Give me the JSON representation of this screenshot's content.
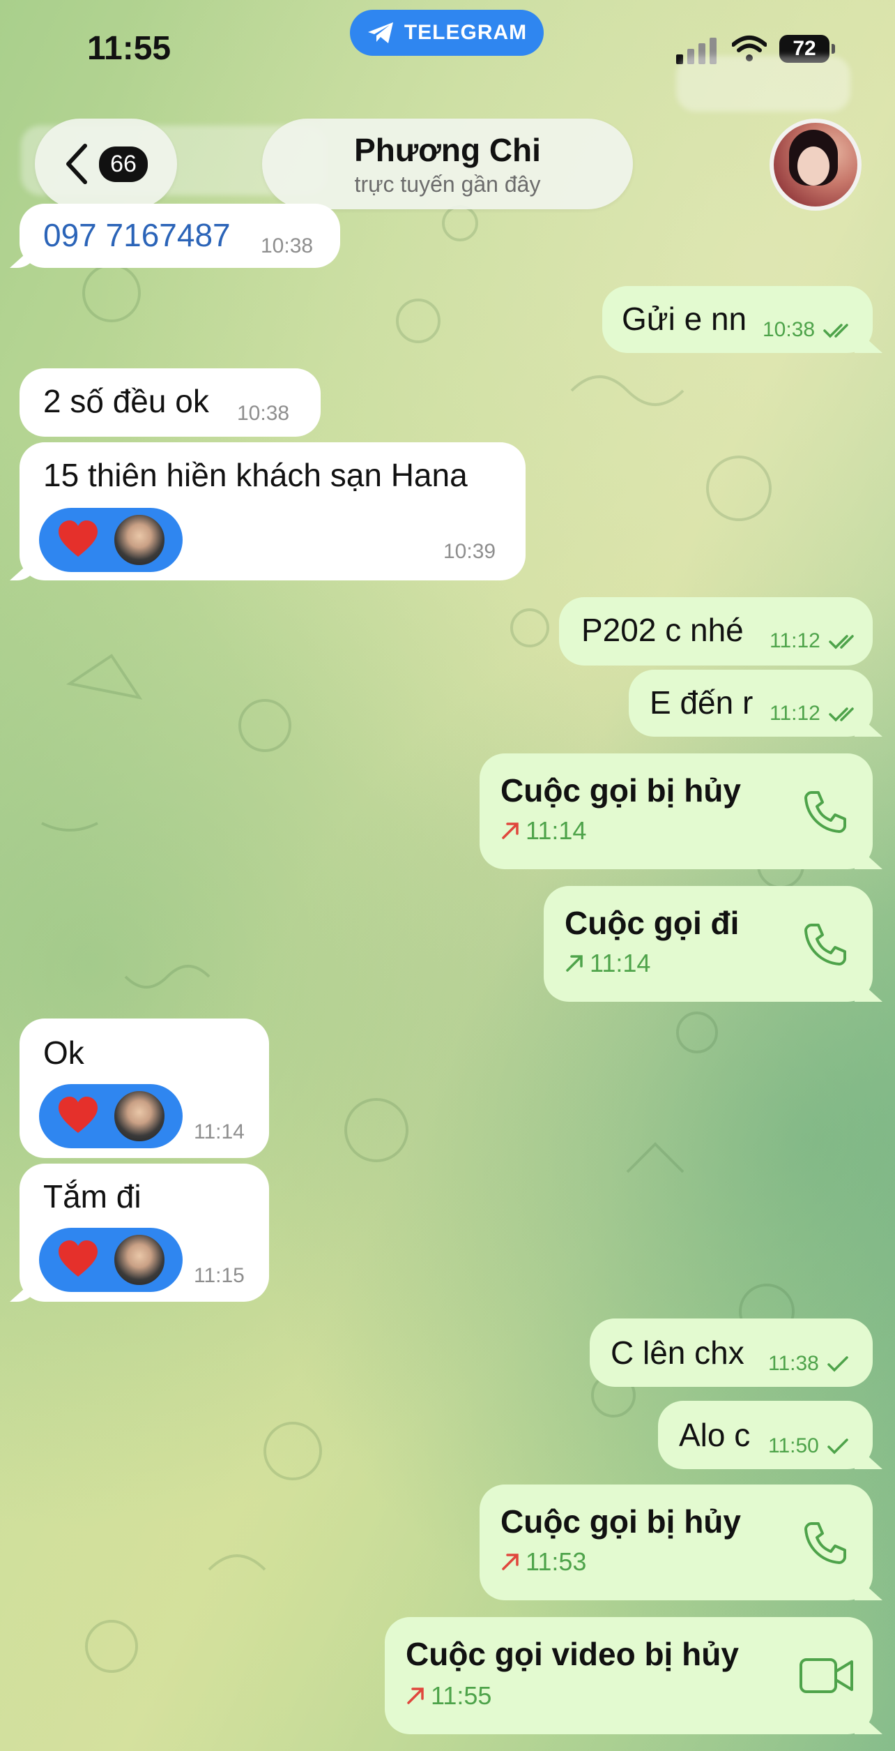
{
  "status_bar": {
    "time": "11:55",
    "app_pill": "TELEGRAM",
    "battery": "72"
  },
  "header": {
    "back_count": "66",
    "name": "Phương Chi",
    "status": "trực tuyến gần đây"
  },
  "messages": [
    {
      "dir": "in",
      "text": "097 7167487",
      "time": "10:38"
    },
    {
      "dir": "out",
      "text": "Gửi e nn",
      "time": "10:38",
      "read": true
    },
    {
      "dir": "in",
      "text": "2 số đều ok",
      "time": "10:38"
    },
    {
      "dir": "in",
      "text": "15 thiên hiền khách sạn Hana",
      "time": "10:39",
      "reaction": "heart"
    },
    {
      "dir": "out",
      "text": "P202 c nhé",
      "time": "11:12",
      "read": true
    },
    {
      "dir": "out",
      "text": "E đến r",
      "time": "11:12",
      "read": true
    },
    {
      "dir": "out",
      "type": "call",
      "title": "Cuộc gọi bị hủy",
      "time": "11:14",
      "missed": true,
      "icon": "phone-icon"
    },
    {
      "dir": "out",
      "type": "call",
      "title": "Cuộc gọi đi",
      "time": "11:14",
      "missed": false,
      "icon": "phone-icon"
    },
    {
      "dir": "in",
      "text": "Ok",
      "time": "11:14",
      "reaction": "heart"
    },
    {
      "dir": "in",
      "text": "Tắm đi",
      "time": "11:15",
      "reaction": "heart"
    },
    {
      "dir": "out",
      "text": "C lên chx",
      "time": "11:38",
      "read": false
    },
    {
      "dir": "out",
      "text": "Alo c",
      "time": "11:50",
      "read": false
    },
    {
      "dir": "out",
      "type": "call",
      "title": "Cuộc gọi bị hủy",
      "time": "11:53",
      "missed": true,
      "icon": "phone-icon"
    },
    {
      "dir": "out",
      "type": "call",
      "title": "Cuộc gọi video bị hủy",
      "time": "11:55",
      "missed": true,
      "icon": "video-icon"
    }
  ],
  "colors": {
    "accent": "#2f86f0",
    "out_bubble": "#e3fad0",
    "in_bubble": "#ffffff",
    "out_time": "#4ea34a",
    "missed_arrow": "#e0463c",
    "link": "#2b64b8"
  }
}
